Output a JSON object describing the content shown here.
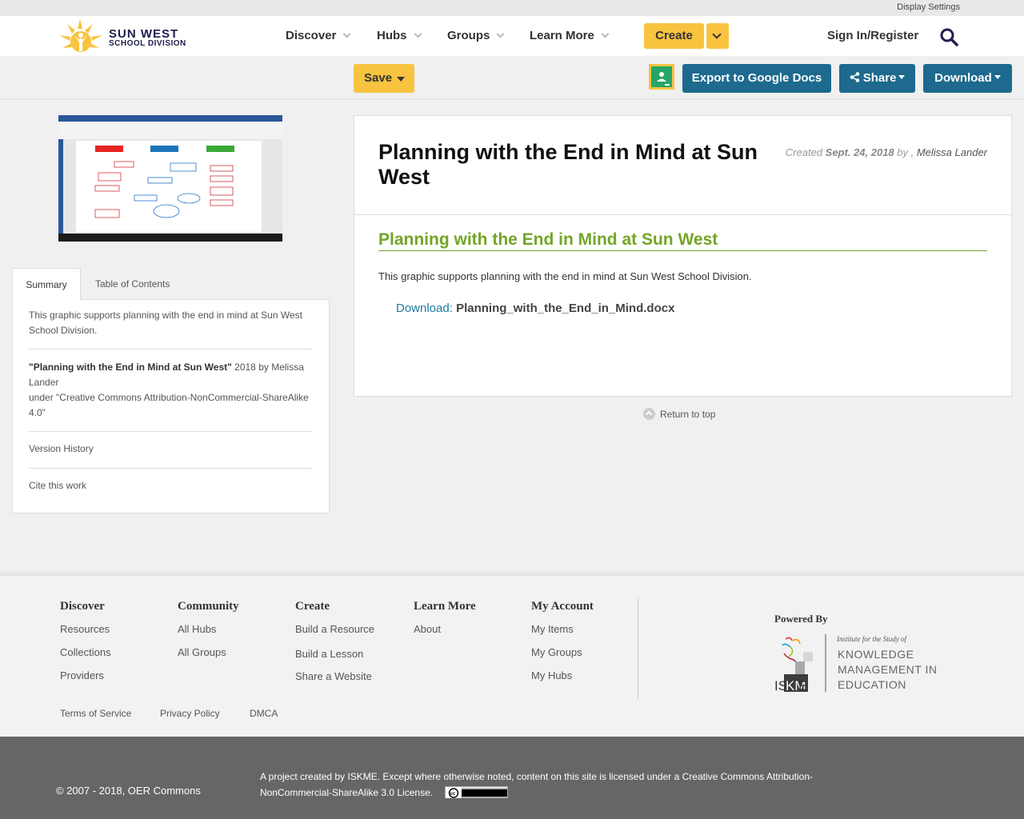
{
  "topbar": {
    "display_settings": "Display Settings"
  },
  "header": {
    "logo_line1": "SUN WEST",
    "logo_line2": "SCHOOL DIVISION",
    "nav": [
      {
        "label": "Discover"
      },
      {
        "label": "Hubs"
      },
      {
        "label": "Groups"
      },
      {
        "label": "Learn More"
      }
    ],
    "create_label": "Create",
    "signin_label": "Sign In/Register"
  },
  "toolbar": {
    "save_label": "Save",
    "export_label": "Export to Google Docs",
    "share_label": "Share",
    "download_label": "Download"
  },
  "sidebar": {
    "tabs": {
      "summary": "Summary",
      "toc": "Table of Contents"
    },
    "summary_text": "This graphic supports planning with the end in mind at Sun West School Division.",
    "attribution_title": "\"Planning with the End in Mind at Sun West\"",
    "attribution_by": " 2018 by Melissa Lander",
    "attribution_license": "under \"Creative Commons Attribution-NonCommercial-ShareAlike 4.0\"",
    "version_history": "Version History",
    "cite": "Cite this work"
  },
  "main": {
    "title": "Planning with the End in Mind at Sun West",
    "created_prefix": "Created ",
    "created_date": "Sept. 24, 2018",
    "created_by": " by , ",
    "author": "Melissa Lander",
    "section_title": "Planning with the End in Mind at Sun West",
    "description": "This graphic supports planning with the end in mind at Sun West School Division.",
    "download_label": "Download:",
    "download_file": "Planning_with_the_End_in_Mind.docx",
    "return_top": "Return to top"
  },
  "footer": {
    "columns": [
      {
        "title": "Discover",
        "links": [
          "Resources",
          "Collections",
          "Providers"
        ]
      },
      {
        "title": "Community",
        "links": [
          "All Hubs",
          "All Groups"
        ]
      },
      {
        "title": "Create",
        "links": [
          "Build a Resource",
          "Build a Lesson",
          "Share a Website"
        ]
      },
      {
        "title": "Learn More",
        "links": [
          "About"
        ]
      },
      {
        "title": "My Account",
        "links": [
          "My Items",
          "My Groups",
          "My Hubs"
        ]
      }
    ],
    "legal": [
      "Terms of Service",
      "Privacy Policy",
      "DMCA"
    ],
    "powered_by": "Powered By",
    "iskme_tagline": "Institute for the Study of",
    "iskme_name_1": "KNOWLEDGE",
    "iskme_name_2": "MANAGEMENT IN",
    "iskme_name_3": "EDUCATION"
  },
  "bottom": {
    "copyright": "© 2007 - 2018, OER Commons",
    "license_text": "A project created by ISKME. Except where otherwise noted, content on this site is licensed under a Creative Commons Attribution-NonCommercial-ShareAlike 3.0 License."
  },
  "colors": {
    "brand_yellow": "#f8c33f",
    "button_blue": "#1d6a8e",
    "section_green": "#72a526",
    "link_blue": "#1d7a9e"
  }
}
